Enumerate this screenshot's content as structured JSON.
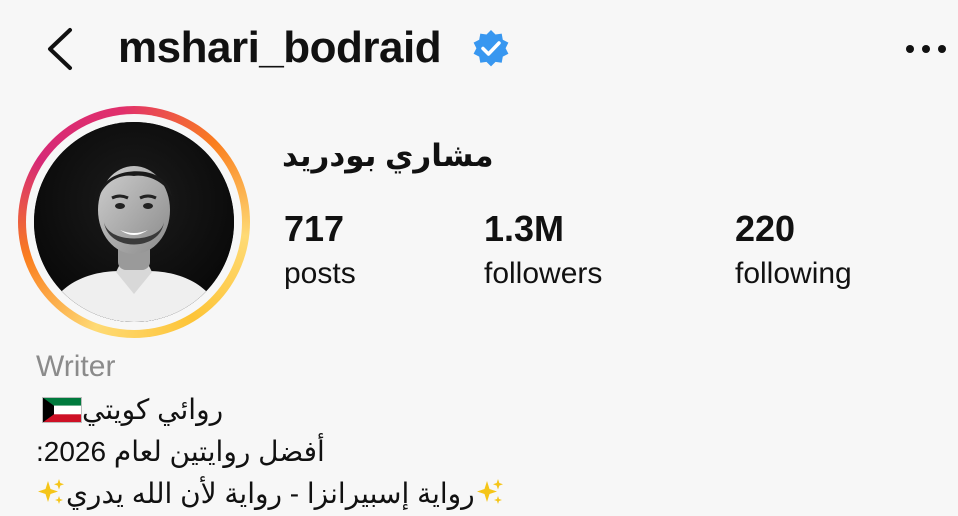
{
  "header": {
    "username": "mshari_bodraid",
    "back_icon": "chevron-left-icon",
    "verified_icon": "verified-badge-icon",
    "more_icon": "ellipsis-icon"
  },
  "profile": {
    "display_name": "مشاري بودريد",
    "stats": [
      {
        "value": "717",
        "label": "posts"
      },
      {
        "value": "1.3M",
        "label": "followers"
      },
      {
        "value": "220",
        "label": "following"
      }
    ]
  },
  "bio": {
    "category": "Writer",
    "line1": "روائي كويتي",
    "line1_emoji": "kuwait-flag",
    "line2": "أفضل روايتين لعام 2026:",
    "line3": "رواية إسبيرانزا - رواية لأن الله يدري",
    "line3_emoji": "sparkles"
  },
  "colors": {
    "verified": "#3897f0",
    "ring_start": "#feda75",
    "ring_end": "#d62976",
    "muted_text": "#8b8b8b"
  }
}
